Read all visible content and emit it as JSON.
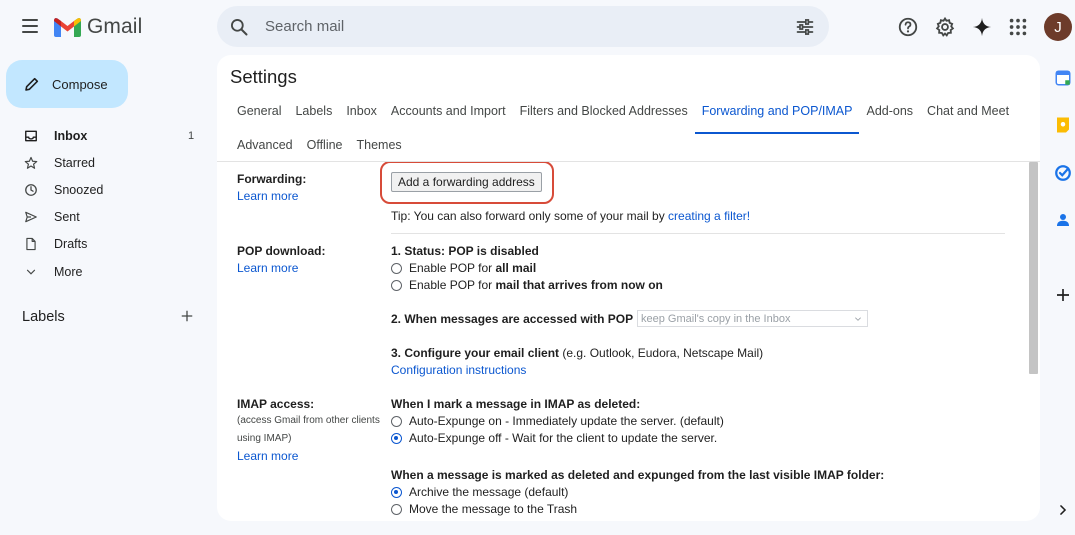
{
  "app": {
    "name": "Gmail"
  },
  "search": {
    "placeholder": "Search mail"
  },
  "user": {
    "initial": "J"
  },
  "colors": {
    "accent": "#0b57d0",
    "compose_bg": "#c2e7ff",
    "highlight": "#d74b39",
    "avatar": "#6d3b2a"
  },
  "compose": {
    "label": "Compose"
  },
  "nav": {
    "items": [
      {
        "label": "Inbox",
        "count": "1",
        "icon": "inbox-icon"
      },
      {
        "label": "Starred",
        "count": "",
        "icon": "star-icon"
      },
      {
        "label": "Snoozed",
        "count": "",
        "icon": "clock-icon"
      },
      {
        "label": "Sent",
        "count": "",
        "icon": "send-icon"
      },
      {
        "label": "Drafts",
        "count": "",
        "icon": "draft-icon"
      },
      {
        "label": "More",
        "count": "",
        "icon": "chevron-down-icon"
      }
    ],
    "labels_heading": "Labels"
  },
  "settings": {
    "title": "Settings",
    "tabs_row1": [
      "General",
      "Labels",
      "Inbox",
      "Accounts and Import",
      "Filters and Blocked Addresses",
      "Forwarding and POP/IMAP",
      "Add-ons",
      "Chat and Meet"
    ],
    "tabs_row2": [
      "Advanced",
      "Offline",
      "Themes"
    ],
    "active_tab": "Forwarding and POP/IMAP",
    "forwarding": {
      "label": "Forwarding:",
      "learn_more": "Learn more",
      "button": "Add a forwarding address",
      "tip_prefix": "Tip: You can also forward only some of your mail by ",
      "tip_link": "creating a filter!"
    },
    "pop": {
      "label": "POP download:",
      "learn_more": "Learn more",
      "status": "1. Status: POP is disabled",
      "option1_prefix": "Enable POP for ",
      "option1_bold": "all mail",
      "option2_prefix": "Enable POP for ",
      "option2_bold": "mail that arrives from now on",
      "when_accessed": "2. When messages are accessed with POP",
      "select_value": "keep Gmail's copy in the Inbox",
      "configure_bold": "3. Configure your email client",
      "configure_rest": " (e.g. Outlook, Eudora, Netscape Mail)",
      "config_link": "Configuration instructions"
    },
    "imap": {
      "label": "IMAP access:",
      "note1": "(access Gmail from other clients",
      "note2": "using IMAP)",
      "learn_more": "Learn more",
      "deleted_heading": "When I mark a message in IMAP as deleted:",
      "expunge_on": "Auto-Expunge on - Immediately update the server. (default)",
      "expunge_off": "Auto-Expunge off - Wait for the client to update the server.",
      "expunged_heading": "When a message is marked as deleted and expunged from the last visible IMAP folder:",
      "archive": "Archive the message (default)",
      "trash": "Move the message to the Trash"
    }
  }
}
